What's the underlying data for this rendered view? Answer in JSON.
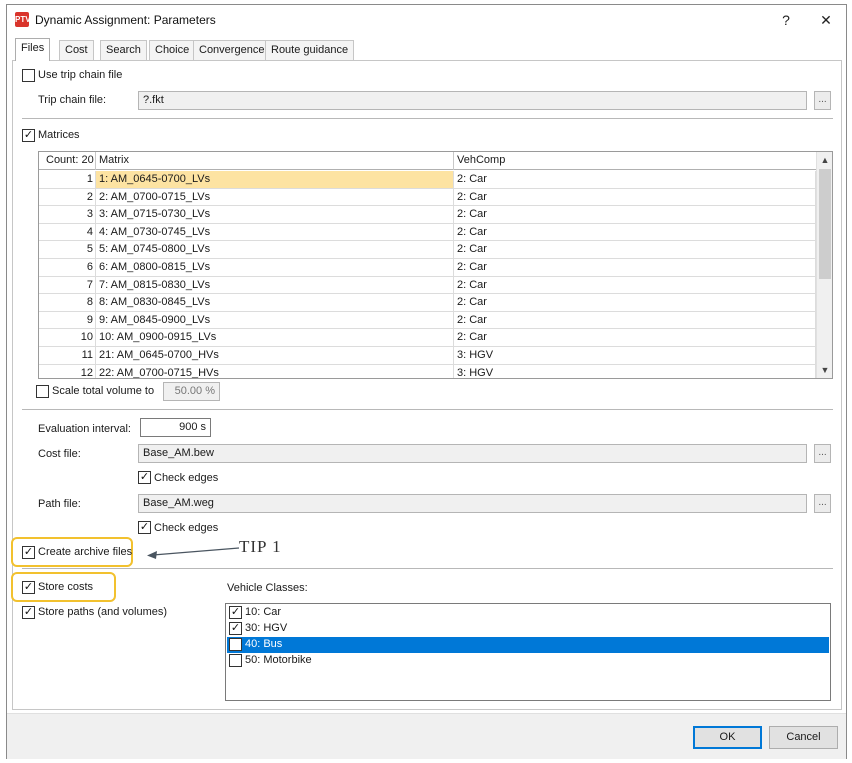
{
  "window": {
    "title": "Dynamic Assignment: Parameters",
    "help": "?",
    "close": "✕",
    "icon_text": "PTV"
  },
  "tabs": [
    "Files",
    "Cost",
    "Search",
    "Choice",
    "Convergence",
    "Route guidance"
  ],
  "trip_chain": {
    "checkbox_label": "Use trip chain file",
    "checked": false,
    "file_label": "Trip chain file:",
    "file_value": "?.fkt",
    "browse": "..."
  },
  "matrices": {
    "checkbox_label": "Matrices",
    "checked": true,
    "columns": [
      "Count: 20",
      "Matrix",
      "VehComp"
    ],
    "rows": [
      {
        "n": "1",
        "matrix": "1: AM_0645-0700_LVs",
        "vehcomp": "2: Car"
      },
      {
        "n": "2",
        "matrix": "2: AM_0700-0715_LVs",
        "vehcomp": "2: Car"
      },
      {
        "n": "3",
        "matrix": "3: AM_0715-0730_LVs",
        "vehcomp": "2: Car"
      },
      {
        "n": "4",
        "matrix": "4: AM_0730-0745_LVs",
        "vehcomp": "2: Car"
      },
      {
        "n": "5",
        "matrix": "5: AM_0745-0800_LVs",
        "vehcomp": "2: Car"
      },
      {
        "n": "6",
        "matrix": "6: AM_0800-0815_LVs",
        "vehcomp": "2: Car"
      },
      {
        "n": "7",
        "matrix": "7: AM_0815-0830_LVs",
        "vehcomp": "2: Car"
      },
      {
        "n": "8",
        "matrix": "8: AM_0830-0845_LVs",
        "vehcomp": "2: Car"
      },
      {
        "n": "9",
        "matrix": "9: AM_0845-0900_LVs",
        "vehcomp": "2: Car"
      },
      {
        "n": "10",
        "matrix": "10: AM_0900-0915_LVs",
        "vehcomp": "2: Car"
      },
      {
        "n": "11",
        "matrix": "21: AM_0645-0700_HVs",
        "vehcomp": "3: HGV"
      },
      {
        "n": "12",
        "matrix": "22: AM_0700-0715_HVs",
        "vehcomp": "3: HGV"
      }
    ],
    "selected_row": 0
  },
  "scale": {
    "checkbox_label": "Scale total volume to",
    "checked": false,
    "value": "50.00 %"
  },
  "evaluation": {
    "label": "Evaluation interval:",
    "value": "900 s"
  },
  "cost_file": {
    "label": "Cost file:",
    "value": "Base_AM.bew",
    "browse": "...",
    "check_edges_label": "Check edges",
    "check_edges": true
  },
  "path_file": {
    "label": "Path file:",
    "value": "Base_AM.weg",
    "browse": "...",
    "check_edges_label": "Check edges",
    "check_edges": true
  },
  "archive": {
    "label": "Create archive files",
    "checked": true
  },
  "annotation": {
    "tip_text": "TIP 1",
    "highlight_color": "#f2c12e"
  },
  "store_costs": {
    "label": "Store costs",
    "checked": true
  },
  "store_paths": {
    "label": "Store paths (and volumes)",
    "checked": true
  },
  "vehicle_classes": {
    "label": "Vehicle Classes:",
    "items": [
      {
        "label": "10: Car",
        "checked": true,
        "selected": false
      },
      {
        "label": "30: HGV",
        "checked": true,
        "selected": false
      },
      {
        "label": "40: Bus",
        "checked": false,
        "selected": true
      },
      {
        "label": "50: Motorbike",
        "checked": false,
        "selected": false
      }
    ]
  },
  "buttons": {
    "ok": "OK",
    "cancel": "Cancel"
  },
  "colors": {
    "selection_blue": "#0078d7",
    "row_highlight": "#fde3a2",
    "app_icon_red": "#d9342b"
  }
}
